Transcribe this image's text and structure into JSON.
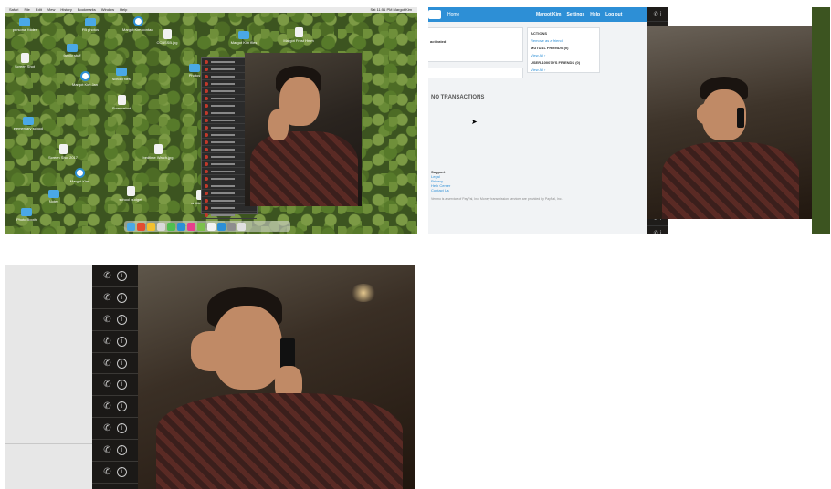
{
  "panel1": {
    "menubar": {
      "items": [
        "Safari",
        "File",
        "Edit",
        "View",
        "History",
        "Bookmarks",
        "Window",
        "Help"
      ],
      "clock": "Sat 11:51 PM   Margot Kim"
    },
    "desktop_icons": [
      {
        "label": "personal folder",
        "type": "folder"
      },
      {
        "label": "FB photos",
        "type": "folder"
      },
      {
        "label": "Margot Kim contact",
        "type": "circle"
      },
      {
        "label": "CCBSSB.jpg",
        "type": "doc"
      },
      {
        "label": "Margot Kim files",
        "type": "folder"
      },
      {
        "label": "Margot Frost Hmm",
        "type": "doc"
      },
      {
        "label": "Screen Shot",
        "type": "doc"
      },
      {
        "label": "family stuff",
        "type": "folder"
      },
      {
        "label": "Margot Kim Jan",
        "type": "circle"
      },
      {
        "label": "school files",
        "type": "folder"
      },
      {
        "label": "Photos",
        "type": "folder"
      },
      {
        "label": "Screenshot",
        "type": "doc"
      },
      {
        "label": "elementary school",
        "type": "folder"
      },
      {
        "label": "Screen Shot 2017",
        "type": "doc"
      },
      {
        "label": "bedtime Watch.jpg",
        "type": "doc"
      },
      {
        "label": "Margot Kim",
        "type": "circle"
      },
      {
        "label": "school budget",
        "type": "doc"
      },
      {
        "label": "Notes",
        "type": "folder"
      },
      {
        "label": "untitled.pdf",
        "type": "doc"
      },
      {
        "label": "Photo Booth",
        "type": "folder"
      }
    ],
    "dock_colors": [
      "#4aa8e6",
      "#e44c30",
      "#f2c12e",
      "#d9d9d9",
      "#4fbf4f",
      "#2c8fd6",
      "#e83e8c",
      "#7cc04b",
      "#f2f2f2",
      "#2c8fd6",
      "#8e8e8e",
      "#e0e0e0"
    ]
  },
  "panel2": {
    "nav": {
      "home": "Home",
      "user": "Margot Kim",
      "settings": "Settings",
      "help": "Help",
      "logout": "Log out"
    },
    "activated": "activated",
    "actions": {
      "title": "ACTIONS",
      "link": "Remove as a friend"
    },
    "mutual": {
      "title": "MUTUAL FRIENDS (0)",
      "link": "View All ›"
    },
    "user_friends": {
      "title": "USER-100079'S FRIENDS (0)",
      "link": "View All ›"
    },
    "no_transactions": "NO TRANSACTIONS",
    "support": {
      "title": "Support",
      "links": [
        "Legal",
        "Privacy",
        "Help Center",
        "Contact Us"
      ]
    },
    "footer": "Venmo is a service of PayPal, Inc. Money transmission services are provided by PayPal, Inc."
  },
  "panel3": {
    "contact_rows": 10
  }
}
